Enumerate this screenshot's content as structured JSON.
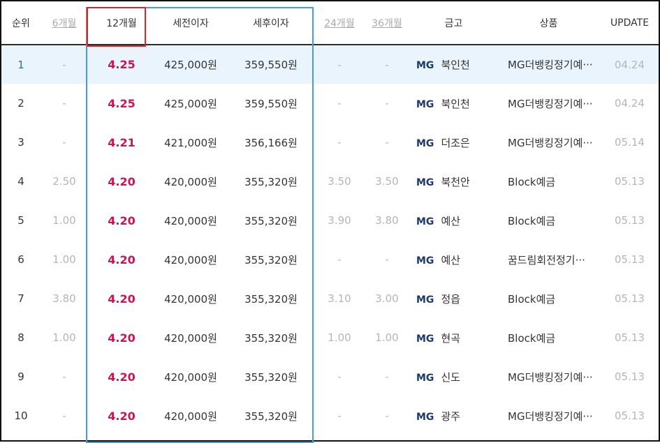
{
  "headers": {
    "rank": "순위",
    "m6": "6개월",
    "m12": "12개월",
    "pretax": "세전이자",
    "aftertax": "세후이자",
    "m24": "24개월",
    "m36": "36개월",
    "bank": "금고",
    "product": "상품",
    "update": "UPDATE"
  },
  "bank_prefix": "MG",
  "colors": {
    "rate": "#cc1454",
    "highlight_row": "#eaf4fc",
    "column_outline": "#41a0da",
    "header_outline": "#d9262b",
    "mg_logo": "#1b3a6b"
  },
  "rows": [
    {
      "rank": "1",
      "m6": "-",
      "m12": "4.25",
      "pretax": "425,000원",
      "aftertax": "359,550원",
      "m24": "-",
      "m36": "-",
      "bank": "북인천",
      "product": "MG더뱅킹정기예···",
      "update": "04.24"
    },
    {
      "rank": "2",
      "m6": "-",
      "m12": "4.25",
      "pretax": "425,000원",
      "aftertax": "359,550원",
      "m24": "-",
      "m36": "-",
      "bank": "북인천",
      "product": "MG더뱅킹정기예···",
      "update": "04.24"
    },
    {
      "rank": "3",
      "m6": "-",
      "m12": "4.21",
      "pretax": "421,000원",
      "aftertax": "356,166원",
      "m24": "-",
      "m36": "-",
      "bank": "더조은",
      "product": "MG더뱅킹정기예···",
      "update": "05.14"
    },
    {
      "rank": "4",
      "m6": "2.50",
      "m12": "4.20",
      "pretax": "420,000원",
      "aftertax": "355,320원",
      "m24": "3.50",
      "m36": "3.50",
      "bank": "북천안",
      "product": "Block예금",
      "update": "05.13"
    },
    {
      "rank": "5",
      "m6": "1.00",
      "m12": "4.20",
      "pretax": "420,000원",
      "aftertax": "355,320원",
      "m24": "3.90",
      "m36": "3.80",
      "bank": "예산",
      "product": "Block예금",
      "update": "05.13"
    },
    {
      "rank": "6",
      "m6": "1.00",
      "m12": "4.20",
      "pretax": "420,000원",
      "aftertax": "355,320원",
      "m24": "-",
      "m36": "-",
      "bank": "예산",
      "product": "꿈드림회전정기···",
      "update": "05.13"
    },
    {
      "rank": "7",
      "m6": "3.80",
      "m12": "4.20",
      "pretax": "420,000원",
      "aftertax": "355,320원",
      "m24": "3.10",
      "m36": "3.00",
      "bank": "정읍",
      "product": "Block예금",
      "update": "05.13"
    },
    {
      "rank": "8",
      "m6": "1.00",
      "m12": "4.20",
      "pretax": "420,000원",
      "aftertax": "355,320원",
      "m24": "1.00",
      "m36": "1.00",
      "bank": "현곡",
      "product": "Block예금",
      "update": "05.13"
    },
    {
      "rank": "9",
      "m6": "-",
      "m12": "4.20",
      "pretax": "420,000원",
      "aftertax": "355,320원",
      "m24": "-",
      "m36": "-",
      "bank": "신도",
      "product": "MG더뱅킹정기예···",
      "update": "05.13"
    },
    {
      "rank": "10",
      "m6": "-",
      "m12": "4.20",
      "pretax": "420,000원",
      "aftertax": "355,320원",
      "m24": "-",
      "m36": "-",
      "bank": "광주",
      "product": "MG더뱅킹정기예···",
      "update": "05.13"
    }
  ]
}
